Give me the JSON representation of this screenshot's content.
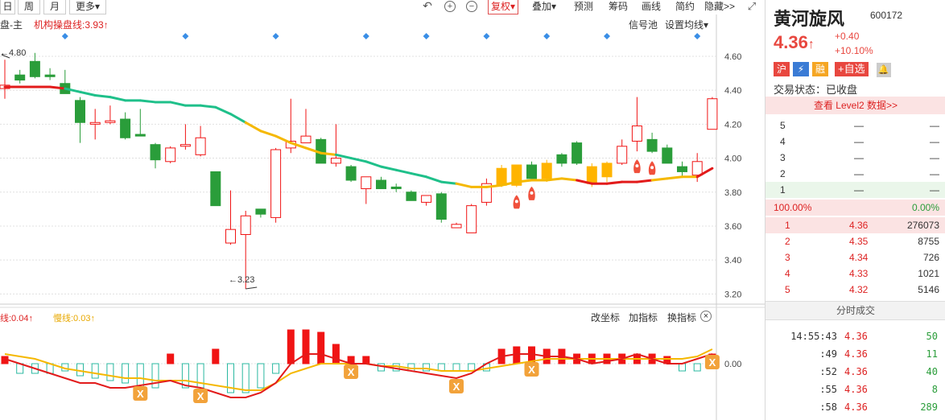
{
  "toolbar": {
    "periods": [
      "日",
      "周",
      "月"
    ],
    "more": "更多",
    "more_arrow": "▾",
    "actions": [
      {
        "label": "复权",
        "arrow": "▾",
        "boxed": true
      },
      {
        "label": "叠加",
        "arrow": "▾",
        "boxed": false
      },
      {
        "label": "预测",
        "arrow": "",
        "boxed": false
      },
      {
        "label": "筹码",
        "arrow": "",
        "boxed": false
      },
      {
        "label": "画线",
        "arrow": "",
        "boxed": false
      },
      {
        "label": "简约",
        "arrow": "",
        "boxed": false
      },
      {
        "label": "隐藏>>",
        "arrow": "",
        "boxed": false
      }
    ],
    "icons": [
      "undo-icon",
      "zoom-in-icon",
      "zoom-out-icon",
      "expand-icon"
    ],
    "icon_glyphs": [
      "↶",
      "+",
      "−",
      "⤢"
    ]
  },
  "main_panel": {
    "indicator_name": "盘-主",
    "indicator_line_label": "机构操盘线:3.93",
    "indicator_arrow": "↑",
    "signal_pool": "信号池",
    "set_ma": "设置均线",
    "set_ma_arrow": "▾",
    "high_marker": "4.80",
    "low_marker": "3.23",
    "high_arrow": "←",
    "low_arrow": "←"
  },
  "sub_panel": {
    "fast_label": "线:0.04",
    "fast_arrow": "↑",
    "slow_label": "慢线:0.03",
    "slow_arrow": "↑",
    "buttons": [
      "改坐标",
      "加指标",
      "换指标"
    ],
    "close_icon": "×",
    "x_badge": "X"
  },
  "chart_data": {
    "type": "candlestick",
    "price_axis": {
      "ticks": [
        "4.60",
        "4.40",
        "4.20",
        "4.00",
        "3.80",
        "3.60",
        "3.40",
        "3.20"
      ],
      "ylim": [
        3.14,
        4.78
      ]
    },
    "sub_axis": {
      "ticks": [
        "0.00"
      ]
    },
    "candles": [
      {
        "o": 4.43,
        "h": 4.58,
        "l": 4.35,
        "c": 4.41
      },
      {
        "o": 4.46,
        "h": 4.52,
        "l": 4.44,
        "c": 4.49
      },
      {
        "o": 4.57,
        "h": 4.62,
        "l": 4.47,
        "c": 4.48
      },
      {
        "o": 4.49,
        "h": 4.53,
        "l": 4.46,
        "c": 4.48
      },
      {
        "o": 4.44,
        "h": 4.52,
        "l": 4.38,
        "c": 4.38
      },
      {
        "o": 4.34,
        "h": 4.36,
        "l": 4.09,
        "c": 4.21
      },
      {
        "o": 4.2,
        "h": 4.29,
        "l": 4.11,
        "c": 4.21
      },
      {
        "o": 4.22,
        "h": 4.31,
        "l": 4.2,
        "c": 4.21
      },
      {
        "o": 4.23,
        "h": 4.27,
        "l": 4.11,
        "c": 4.12
      },
      {
        "o": 4.14,
        "h": 4.29,
        "l": 4.13,
        "c": 4.13
      },
      {
        "o": 4.08,
        "h": 4.09,
        "l": 3.94,
        "c": 3.99
      },
      {
        "o": 3.98,
        "h": 4.07,
        "l": 3.97,
        "c": 4.06
      },
      {
        "o": 4.07,
        "h": 4.2,
        "l": 4.05,
        "c": 4.08
      },
      {
        "o": 4.02,
        "h": 4.19,
        "l": 4.01,
        "c": 4.12
      },
      {
        "o": 3.92,
        "h": 3.92,
        "l": 3.74,
        "c": 3.72
      },
      {
        "o": 3.5,
        "h": 3.81,
        "l": 3.49,
        "c": 3.58
      },
      {
        "o": 3.55,
        "h": 3.69,
        "l": 3.23,
        "c": 3.66
      },
      {
        "o": 3.67,
        "h": 3.7,
        "l": 3.65,
        "c": 3.7
      },
      {
        "o": 3.65,
        "h": 4.06,
        "l": 3.62,
        "c": 4.05
      },
      {
        "o": 4.06,
        "h": 4.35,
        "l": 4.03,
        "c": 4.1
      },
      {
        "o": 4.09,
        "h": 4.29,
        "l": 4.1,
        "c": 4.13
      },
      {
        "o": 4.11,
        "h": 4.12,
        "l": 3.97,
        "c": 3.97
      },
      {
        "o": 3.97,
        "h": 4.2,
        "l": 3.95,
        "c": 4.0
      },
      {
        "o": 3.95,
        "h": 3.96,
        "l": 3.86,
        "c": 3.87
      },
      {
        "o": 3.82,
        "h": 3.85,
        "l": 3.73,
        "c": 3.89
      },
      {
        "o": 3.87,
        "h": 3.89,
        "l": 3.83,
        "c": 3.82
      },
      {
        "o": 3.83,
        "h": 3.85,
        "l": 3.8,
        "c": 3.82
      },
      {
        "o": 3.8,
        "h": 3.81,
        "l": 3.75,
        "c": 3.75
      },
      {
        "o": 3.74,
        "h": 3.77,
        "l": 3.72,
        "c": 3.78
      },
      {
        "o": 3.79,
        "h": 3.8,
        "l": 3.62,
        "c": 3.64
      },
      {
        "o": 3.59,
        "h": 3.62,
        "l": 3.6,
        "c": 3.61
      },
      {
        "o": 3.56,
        "h": 3.73,
        "l": 3.56,
        "c": 3.72
      },
      {
        "o": 3.74,
        "h": 3.88,
        "l": 3.72,
        "c": 3.85
      },
      {
        "o": 3.84,
        "h": 3.96,
        "l": 3.83,
        "c": 3.94
      },
      {
        "o": 3.84,
        "h": 3.96,
        "l": 3.83,
        "c": 3.96
      },
      {
        "o": 3.96,
        "h": 3.98,
        "l": 3.88,
        "c": 3.88
      },
      {
        "o": 3.88,
        "h": 3.99,
        "l": 3.86,
        "c": 3.97
      },
      {
        "o": 4.02,
        "h": 4.03,
        "l": 3.95,
        "c": 3.97
      },
      {
        "o": 4.09,
        "h": 4.1,
        "l": 3.96,
        "c": 3.97
      },
      {
        "o": 3.95,
        "h": 3.97,
        "l": 3.83,
        "c": 3.85
      },
      {
        "o": 3.89,
        "h": 3.98,
        "l": 3.86,
        "c": 3.97
      },
      {
        "o": 3.97,
        "h": 4.11,
        "l": 3.96,
        "c": 4.07
      },
      {
        "o": 4.1,
        "h": 4.36,
        "l": 4.04,
        "c": 4.19
      },
      {
        "o": 4.11,
        "h": 4.15,
        "l": 4.03,
        "c": 4.04
      },
      {
        "o": 4.06,
        "h": 4.08,
        "l": 3.98,
        "c": 3.97
      },
      {
        "o": 3.95,
        "h": 3.98,
        "l": 3.89,
        "c": 3.92
      },
      {
        "o": 3.9,
        "h": 4.03,
        "l": 3.86,
        "c": 3.98
      },
      {
        "o": 4.17,
        "h": 4.36,
        "l": 4.18,
        "c": 4.35
      }
    ],
    "candle_colors": [
      "red",
      "green",
      "green",
      "green",
      "green",
      "green",
      "red",
      "red",
      "green",
      "green",
      "green",
      "red",
      "red",
      "red",
      "green",
      "red",
      "red",
      "green",
      "red",
      "red",
      "red",
      "green",
      "red",
      "green",
      "red",
      "green",
      "green",
      "green",
      "red",
      "green",
      "red",
      "red",
      "red",
      "yellow",
      "yellow",
      "green",
      "yellow",
      "green",
      "green",
      "yellow",
      "yellow",
      "red",
      "red",
      "green",
      "green",
      "green",
      "red",
      "red"
    ],
    "ops_line": [
      4.42,
      4.42,
      4.42,
      4.42,
      4.41,
      4.39,
      4.37,
      4.36,
      4.34,
      4.34,
      4.33,
      4.33,
      4.31,
      4.31,
      4.3,
      4.26,
      4.21,
      4.16,
      4.13,
      4.09,
      4.06,
      4.03,
      4.02,
      4.0,
      3.98,
      3.95,
      3.93,
      3.91,
      3.89,
      3.86,
      3.85,
      3.83,
      3.83,
      3.84,
      3.86,
      3.87,
      3.87,
      3.88,
      3.87,
      3.85,
      3.85,
      3.86,
      3.86,
      3.87,
      3.88,
      3.89,
      3.89,
      3.94
    ],
    "ops_line_colors": [
      "red",
      "red",
      "red",
      "red",
      "green",
      "green",
      "green",
      "green",
      "green",
      "green",
      "green",
      "green",
      "green",
      "green",
      "green",
      "green",
      "yellow",
      "yellow",
      "yellow",
      "yellow",
      "yellow",
      "yellow",
      "green",
      "green",
      "green",
      "green",
      "green",
      "green",
      "green",
      "green",
      "yellow",
      "yellow",
      "yellow",
      "yellow",
      "yellow",
      "yellow",
      "yellow",
      "yellow",
      "red",
      "red",
      "red",
      "red",
      "red",
      "yellow",
      "yellow",
      "yellow",
      "red",
      "red"
    ],
    "rockets": [
      34,
      35,
      42,
      43
    ],
    "diamonds": [
      4,
      12,
      18,
      24,
      28,
      32,
      36,
      40,
      46
    ],
    "macd_bars": [
      0.015,
      -0.02,
      -0.02,
      -0.02,
      -0.015,
      -0.025,
      -0.03,
      -0.035,
      -0.04,
      -0.05,
      -0.05,
      0.02,
      -0.05,
      -0.05,
      0.03,
      -0.06,
      -0.06,
      -0.05,
      -0.02,
      0.07,
      0.07,
      0.065,
      0.04,
      0.015,
      0.015,
      -0.015,
      -0.015,
      -0.015,
      -0.015,
      -0.015,
      -0.015,
      -0.015,
      -0.015,
      0.03,
      0.035,
      0.035,
      0.03,
      0.03,
      0.02,
      0.02,
      0.02,
      0.02,
      0.02,
      0.02,
      0.015,
      -0.015,
      -0.015,
      0.02
    ],
    "fast_line": [
      0.01,
      0.0,
      -0.01,
      -0.02,
      -0.03,
      -0.04,
      -0.04,
      -0.05,
      -0.05,
      -0.045,
      -0.04,
      -0.035,
      -0.045,
      -0.05,
      -0.06,
      -0.07,
      -0.07,
      -0.06,
      -0.04,
      0.0,
      0.02,
      0.02,
      0.01,
      0.0,
      0.0,
      -0.005,
      -0.01,
      -0.015,
      -0.02,
      -0.025,
      -0.03,
      -0.02,
      0.0,
      0.015,
      0.02,
      0.02,
      0.015,
      0.015,
      0.01,
      0.0,
      0.005,
      0.01,
      0.02,
      0.01,
      0.0,
      0.0,
      0.01,
      0.02
    ],
    "slow_line": [
      0.02,
      0.015,
      0.01,
      0.0,
      -0.01,
      -0.015,
      -0.02,
      -0.025,
      -0.03,
      -0.03,
      -0.035,
      -0.035,
      -0.035,
      -0.04,
      -0.045,
      -0.05,
      -0.055,
      -0.055,
      -0.04,
      -0.02,
      -0.01,
      0.0,
      0.0,
      0.0,
      0.0,
      -0.005,
      -0.005,
      -0.01,
      -0.01,
      -0.015,
      -0.015,
      -0.015,
      -0.01,
      -0.005,
      0.0,
      0.005,
      0.01,
      0.01,
      0.01,
      0.01,
      0.01,
      0.01,
      0.01,
      0.01,
      0.01,
      0.01,
      0.015,
      0.03
    ],
    "x_badges": [
      9,
      13,
      23,
      30,
      35,
      47
    ]
  },
  "quote": {
    "name": "黄河旋风",
    "code": "600172",
    "price": "4.36",
    "price_arrow": "↑",
    "change": "+0.40",
    "change_pct": "+10.10%",
    "tags": [
      {
        "label": "沪",
        "bg": "#e8473f"
      },
      {
        "label": "⚡",
        "bg": "#3a7bd5"
      },
      {
        "label": "融",
        "bg": "#f5a623"
      }
    ],
    "add_watch": "+自选",
    "bell_icon": "🔔",
    "status": "交易状态：已收盘",
    "level2": "查看 Level2 数据>>"
  },
  "order_book": {
    "sells": [
      {
        "level": "5",
        "price": "—",
        "vol": "—"
      },
      {
        "level": "4",
        "price": "—",
        "vol": "—"
      },
      {
        "level": "3",
        "price": "—",
        "vol": "—"
      },
      {
        "level": "2",
        "price": "—",
        "vol": "—"
      },
      {
        "level": "1",
        "price": "—",
        "vol": "—"
      }
    ],
    "ratio_left": "100.00%",
    "ratio_right": "0.00%",
    "buys": [
      {
        "level": "1",
        "price": "4.36",
        "vol": "276073"
      },
      {
        "level": "2",
        "price": "4.35",
        "vol": "8755"
      },
      {
        "level": "3",
        "price": "4.34",
        "vol": "726"
      },
      {
        "level": "4",
        "price": "4.33",
        "vol": "1021"
      },
      {
        "level": "5",
        "price": "4.32",
        "vol": "5146"
      }
    ]
  },
  "ticks": {
    "title": "分时成交",
    "rows": [
      {
        "time": "14:55:43",
        "price": "4.36",
        "vol": "50"
      },
      {
        "time": ":49",
        "price": "4.36",
        "vol": "11"
      },
      {
        "time": ":52",
        "price": "4.36",
        "vol": "40"
      },
      {
        "time": ":55",
        "price": "4.36",
        "vol": "8"
      },
      {
        "time": ":58",
        "price": "4.36",
        "vol": "289"
      }
    ]
  }
}
